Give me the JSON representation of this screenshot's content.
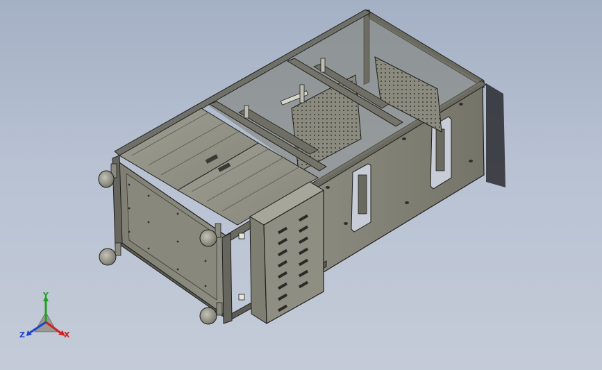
{
  "view": {
    "background_top": "#a4b0c4",
    "background_bottom": "#c4cbd8"
  },
  "model": {
    "body_color": "#8e8e82",
    "frame_color": "#5c5c54",
    "edge_color": "#1e1e1c"
  },
  "triad": {
    "x_label": "X",
    "y_label": "Y",
    "z_label": "Z",
    "x_color": "#d02020",
    "y_color": "#20a020",
    "z_color": "#2040d0"
  }
}
